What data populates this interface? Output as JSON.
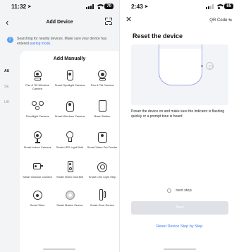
{
  "left_screen": {
    "status": {
      "time": "11:32",
      "battery": "70"
    },
    "title": "Add Device",
    "search_banner": {
      "text": "Searching for nearby devices. Make sure your device has entered",
      "link": "pairing mode."
    },
    "sidebar": [
      "AU",
      "SE",
      "LIK"
    ],
    "section_title": "Add Manually",
    "devices": [
      {
        "label": "Pan & Tilt Wireless Camera",
        "icon": "pan-tilt-camera-icon"
      },
      {
        "label": "Smart Spotlight Camera",
        "icon": "spotlight-camera-icon"
      },
      {
        "label": "Pan & Tilt Camera",
        "icon": "pan-tilt-camera-icon"
      },
      {
        "label": "Floodlight Camera",
        "icon": "floodlight-camera-icon"
      },
      {
        "label": "Smart Wireless Camera",
        "icon": "wireless-camera-icon"
      },
      {
        "label": "Base Station",
        "icon": "base-station-icon"
      },
      {
        "label": "Smart Indoor Camera",
        "icon": "indoor-camera-icon"
      },
      {
        "label": "Smart LED Light Bulb",
        "icon": "light-bulb-icon"
      },
      {
        "label": "Smart Video Pet Feeder",
        "icon": "pet-feeder-icon"
      },
      {
        "label": "Smart Outdoor Camera",
        "icon": "outdoor-camera-icon"
      },
      {
        "label": "Smart Video Doorbell",
        "icon": "video-doorbell-icon"
      },
      {
        "label": "Smart LED Light Strip",
        "icon": "light-strip-icon"
      },
      {
        "label": "Smart Siren",
        "icon": "siren-icon"
      },
      {
        "label": "Smart Motion Sensor",
        "icon": "motion-sensor-icon"
      },
      {
        "label": "Smart Door Sensor",
        "icon": "door-sensor-icon"
      }
    ]
  },
  "right_screen": {
    "status": {
      "time": "2:43",
      "battery": "65"
    },
    "qr_label": "QR Code",
    "title": "Reset the device",
    "instruction": "Power the device on and make sure the indicator is flashing quickly or a prompt tone is heard",
    "next_step_label": "next step",
    "next_button": "Next",
    "reset_link": "Reset Device Step by Step"
  },
  "colors": {
    "accent": "#3d7be8",
    "disabled_button": "#dfe1e6",
    "illustration_outline": "#9aa6e8"
  }
}
